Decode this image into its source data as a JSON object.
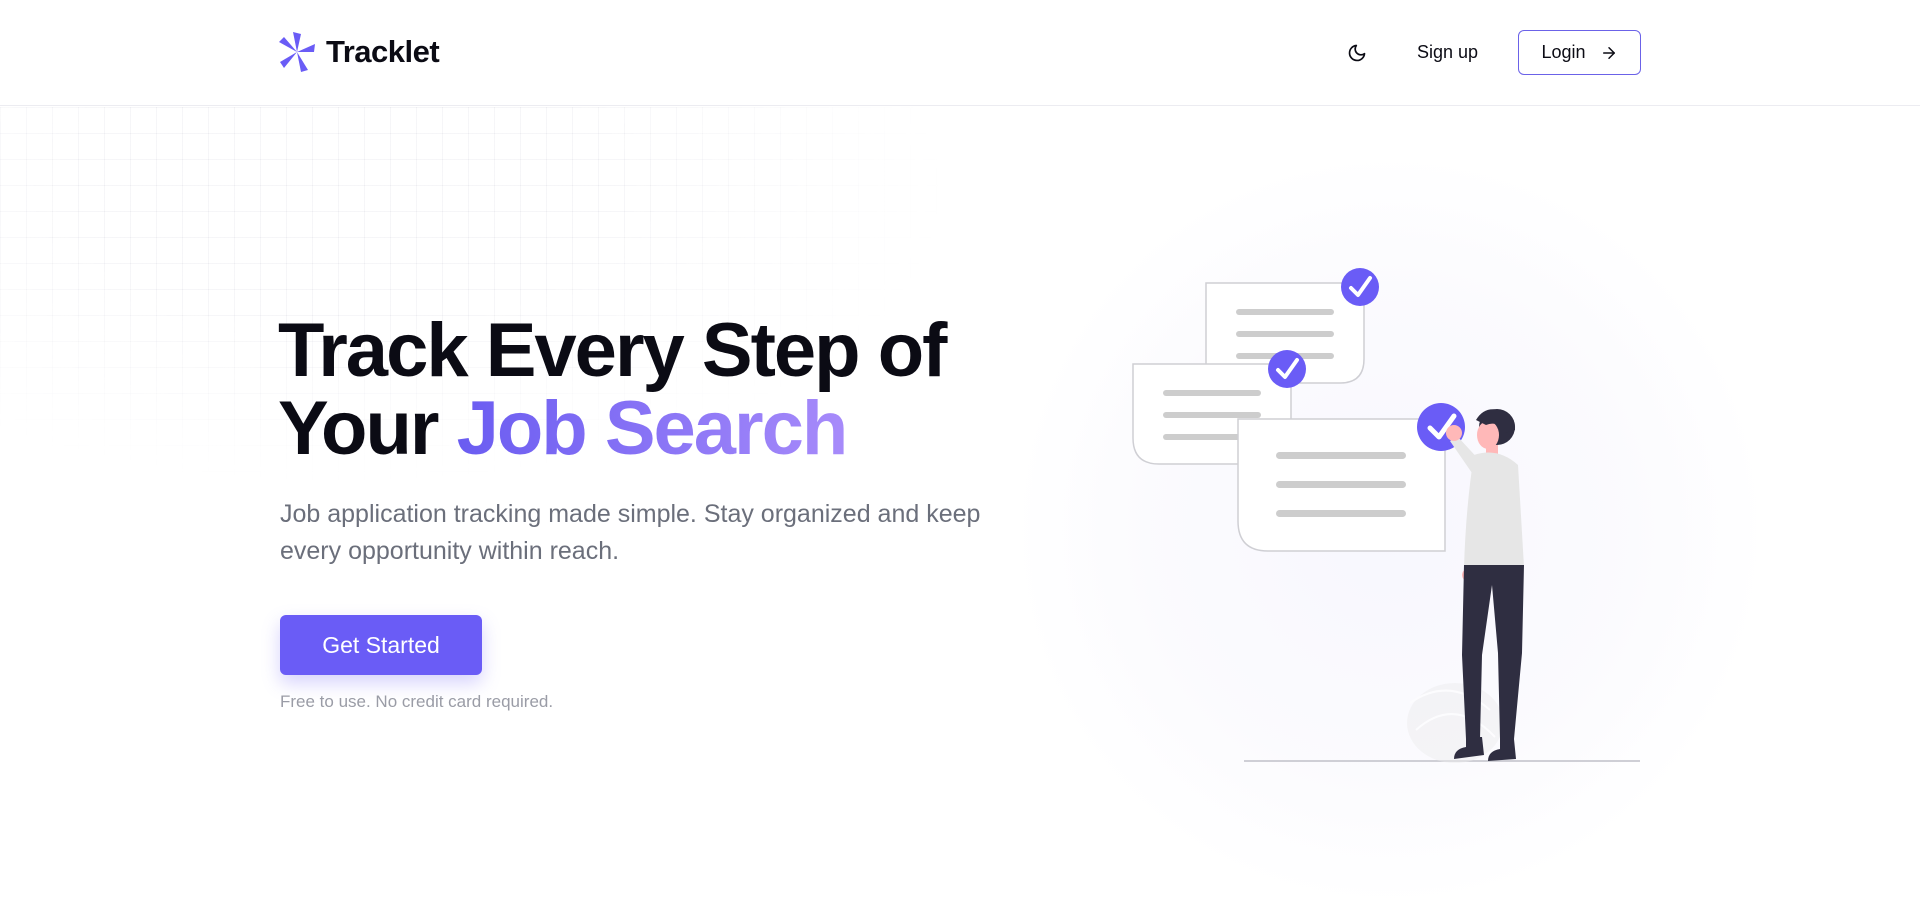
{
  "header": {
    "brand_name": "Tracklet",
    "signup_label": "Sign up",
    "login_label": "Login"
  },
  "hero": {
    "title_line1": "Track Every Step of",
    "title_line2_plain": "Your ",
    "title_line2_accent": "Job Search",
    "subtitle": "Job application tracking made simple. Stay organized and keep every opportunity within reach.",
    "cta_label": "Get Started",
    "cta_note": "Free to use. No credit card required."
  },
  "icons": {
    "brand": "pinwheel-logo-icon",
    "theme": "moon-icon",
    "login": "arrow-right-icon"
  },
  "colors": {
    "accent": "#6a5cf6",
    "accent_gradient_end": "#a78bfa",
    "text_primary": "#0b0b14",
    "text_muted": "#6b6f7b"
  }
}
